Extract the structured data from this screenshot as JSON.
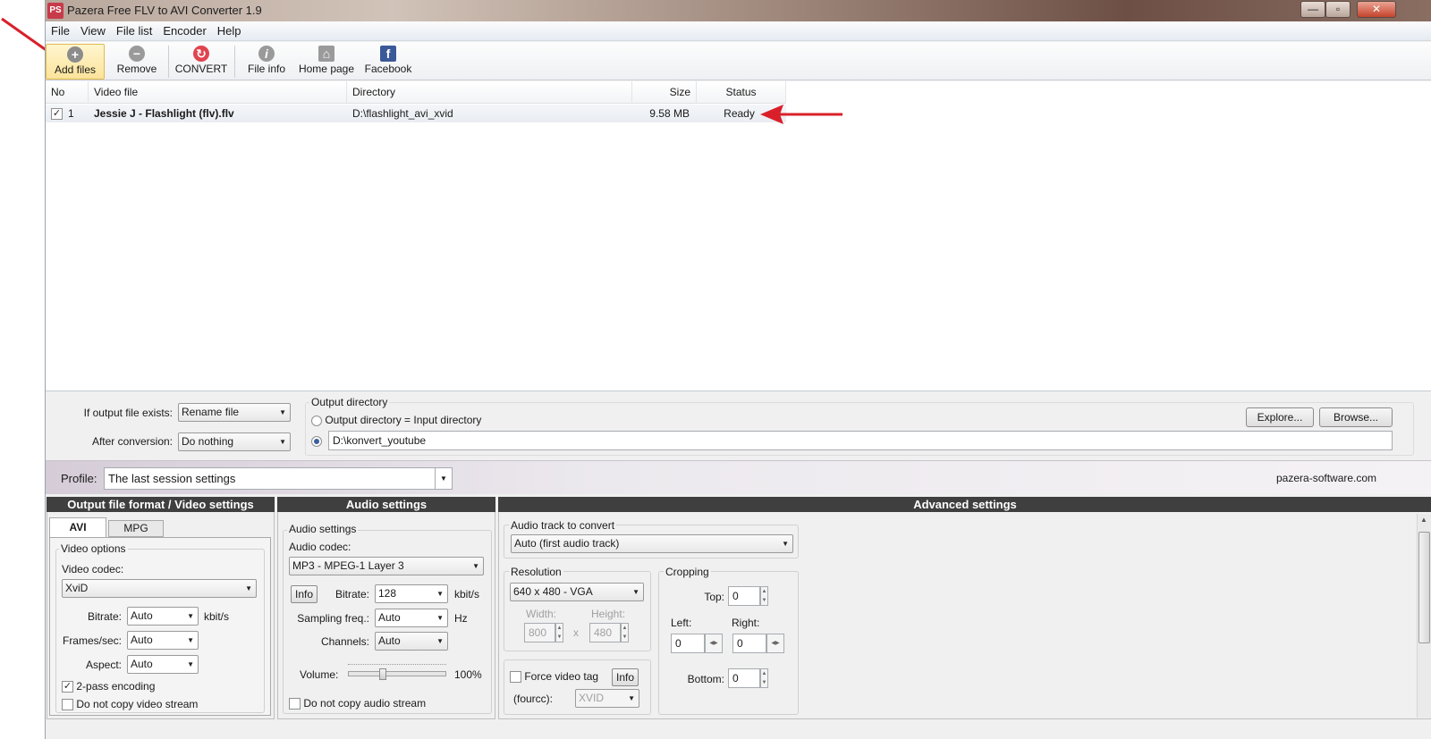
{
  "window": {
    "title": "Pazera Free FLV to AVI Converter 1.9",
    "icon_text": "PS",
    "controls": {
      "minimize": "—",
      "maximize": "▫",
      "close": "✕"
    }
  },
  "menu": [
    "File",
    "View",
    "File list",
    "Encoder",
    "Help"
  ],
  "toolbar": {
    "add_files": "Add files",
    "remove": "Remove",
    "convert": "CONVERT",
    "file_info": "File info",
    "home_page": "Home page",
    "facebook": "Facebook"
  },
  "file_list": {
    "columns": {
      "no": "No",
      "video_file": "Video file",
      "directory": "Directory",
      "size": "Size",
      "status": "Status"
    },
    "rows": [
      {
        "checked": "✓",
        "no": "1",
        "video_file": "Jessie J - Flashlight (flv).flv",
        "directory": "D:\\flashlight_avi_xvid",
        "size": "9.58 MB",
        "status": "Ready"
      }
    ]
  },
  "output": {
    "if_exists_label": "If output file exists:",
    "if_exists_value": "Rename file",
    "after_conversion_label": "After conversion:",
    "after_conversion_value": "Do nothing",
    "dir_group_label": "Output directory",
    "radio_same": "Output directory = Input directory",
    "custom_dir_value": "D:\\konvert_youtube",
    "explore_btn": "Explore...",
    "browse_btn": "Browse..."
  },
  "profile": {
    "label": "Profile:",
    "value": "The last session settings",
    "website": "pazera-software.com"
  },
  "video_section": {
    "header": "Output file format / Video settings",
    "tab_avi": "AVI",
    "tab_mpg": "MPG",
    "group_label": "Video options",
    "codec_label": "Video codec:",
    "codec_value": "XviD",
    "bitrate_label": "Bitrate:",
    "bitrate_value": "Auto",
    "bitrate_unit": "kbit/s",
    "fps_label": "Frames/sec:",
    "fps_value": "Auto",
    "aspect_label": "Aspect:",
    "aspect_value": "Auto",
    "two_pass_label": "2-pass encoding",
    "two_pass_mark": "✓",
    "no_copy_video_label": "Do not copy video stream"
  },
  "audio_section": {
    "header": "Audio settings",
    "group_label": "Audio settings",
    "codec_label": "Audio codec:",
    "codec_value": "MP3 - MPEG-1 Layer 3",
    "info_btn": "Info",
    "bitrate_label": "Bitrate:",
    "bitrate_value": "128",
    "bitrate_unit": "kbit/s",
    "sampling_label": "Sampling freq.:",
    "sampling_value": "Auto",
    "sampling_unit": "Hz",
    "channels_label": "Channels:",
    "channels_value": "Auto",
    "volume_label": "Volume:",
    "volume_value": "100%",
    "no_copy_audio_label": "Do not copy audio stream"
  },
  "advanced_section": {
    "header": "Advanced settings",
    "audio_track_label": "Audio track to convert",
    "audio_track_value": "Auto (first audio track)",
    "resolution_label": "Resolution",
    "resolution_value": "640 x 480 - VGA",
    "width_label": "Width:",
    "width_value": "800",
    "height_label": "Height:",
    "height_value": "480",
    "x_sep": "x",
    "cropping_label": "Cropping",
    "top_label": "Top:",
    "top_value": "0",
    "left_label": "Left:",
    "left_value": "0",
    "right_label": "Right:",
    "right_value": "0",
    "bottom_label": "Bottom:",
    "bottom_value": "0",
    "force_tag_label": "Force video tag",
    "force_info_btn": "Info",
    "fourcc_label": "(fourcc):",
    "fourcc_value": "XVID"
  },
  "colors": {
    "annotation_arrow": "#d9202a",
    "section_header": "#3f3f3f"
  }
}
